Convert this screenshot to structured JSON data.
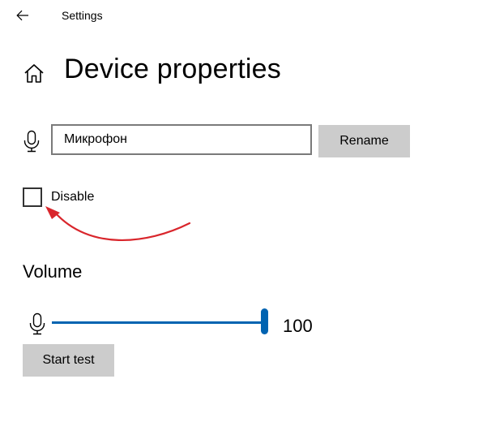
{
  "titlebar": {
    "title": "Settings",
    "back_icon": "back-arrow-icon"
  },
  "header": {
    "home_icon": "home-icon",
    "title": "Device properties"
  },
  "device": {
    "mic_icon": "microphone-icon",
    "name_value": "Микрофон",
    "rename_label": "Rename",
    "disable_label": "Disable",
    "disable_checked": false
  },
  "volume": {
    "title": "Volume",
    "mic_icon": "microphone-icon",
    "level": 100,
    "value_text": "100",
    "start_test_label": "Start test"
  },
  "annotation": {
    "arrow_color": "#d9262c"
  },
  "colors": {
    "accent": "#0063b1",
    "button_bg": "#cccccc"
  }
}
